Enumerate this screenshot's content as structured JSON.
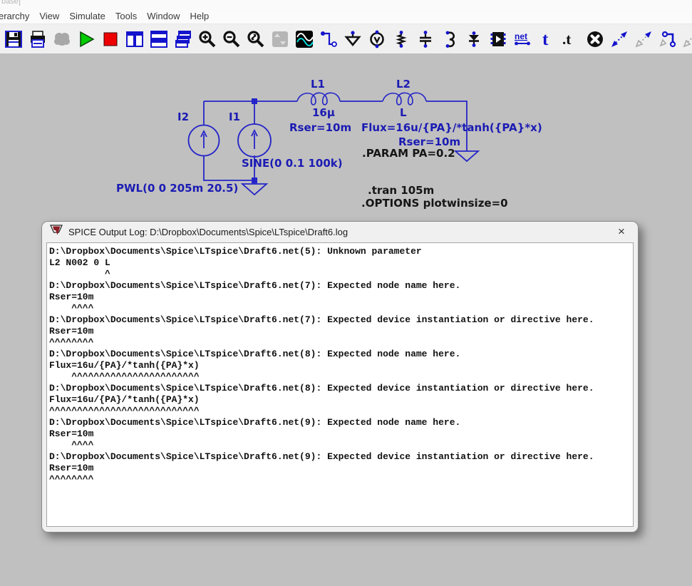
{
  "window": {
    "title_fragment": "base]"
  },
  "menu": {
    "items": [
      "erarchy",
      "View",
      "Simulate",
      "Tools",
      "Window",
      "Help"
    ]
  },
  "toolbar": {
    "icons": [
      "save-icon",
      "print-icon",
      "control-panel-icon",
      "run-icon",
      "halt-icon",
      "tile-vertical-icon",
      "tile-horizontal-icon",
      "cascade-windows-icon",
      "zoom-in-icon",
      "zoom-out-icon",
      "zoom-extents-icon",
      "pan-icon",
      "waveform-icon",
      "wire-icon",
      "ground-icon",
      "voltage-source-icon",
      "resistor-icon",
      "capacitor-icon",
      "inductor-icon",
      "diode-icon",
      "component-icon",
      "net-name-icon",
      "text-icon",
      "spice-directive-icon",
      "delete-icon",
      "move-icon",
      "drag-icon",
      "wire-drag-icon",
      "rotate-icon"
    ]
  },
  "schematic": {
    "components": {
      "i2": {
        "name": "I2",
        "value": "PWL(0 0 205m 20.5)"
      },
      "i1": {
        "name": "I1",
        "value": "SINE(0 0.1 100k)"
      },
      "l1": {
        "name": "L1",
        "value": "16µ",
        "rser": "Rser=10m"
      },
      "l2": {
        "name": "L2",
        "value": "L",
        "flux": "Flux=16u/{PA}/*tanh({PA}*x)",
        "rser": "Rser=10m"
      }
    },
    "directives": {
      "param": ".PARAM PA=0.2",
      "tran": ".tran 105m",
      "options": ".OPTIONS plotwinsize=0"
    }
  },
  "dialog": {
    "title": "SPICE Output Log: D:\\Dropbox\\Documents\\Spice\\LTspice\\Draft6.log",
    "close_glyph": "×",
    "log_lines": [
      "D:\\Dropbox\\Documents\\Spice\\LTspice\\Draft6.net(5): Unknown parameter",
      "L2 N002 0 L",
      "          ^",
      "D:\\Dropbox\\Documents\\Spice\\LTspice\\Draft6.net(7): Expected node name here.",
      "Rser=10m",
      "    ^^^^",
      "D:\\Dropbox\\Documents\\Spice\\LTspice\\Draft6.net(7): Expected device instantiation or directive here.",
      "Rser=10m",
      "^^^^^^^^",
      "D:\\Dropbox\\Documents\\Spice\\LTspice\\Draft6.net(8): Expected node name here.",
      "Flux=16u/{PA}/*tanh({PA}*x)",
      "    ^^^^^^^^^^^^^^^^^^^^^^^",
      "D:\\Dropbox\\Documents\\Spice\\LTspice\\Draft6.net(8): Expected device instantiation or directive here.",
      "Flux=16u/{PA}/*tanh({PA}*x)",
      "^^^^^^^^^^^^^^^^^^^^^^^^^^^",
      "D:\\Dropbox\\Documents\\Spice\\LTspice\\Draft6.net(9): Expected node name here.",
      "Rser=10m",
      "    ^^^^",
      "D:\\Dropbox\\Documents\\Spice\\LTspice\\Draft6.net(9): Expected device instantiation or directive here.",
      "Rser=10m",
      "^^^^^^^^"
    ]
  },
  "colors": {
    "schematic_bg": "#c0c0c0",
    "schematic_blue": "#2424c8",
    "label_blue": "#1b1bb4",
    "run_green": "#00c200",
    "halt_red": "#e80000"
  }
}
